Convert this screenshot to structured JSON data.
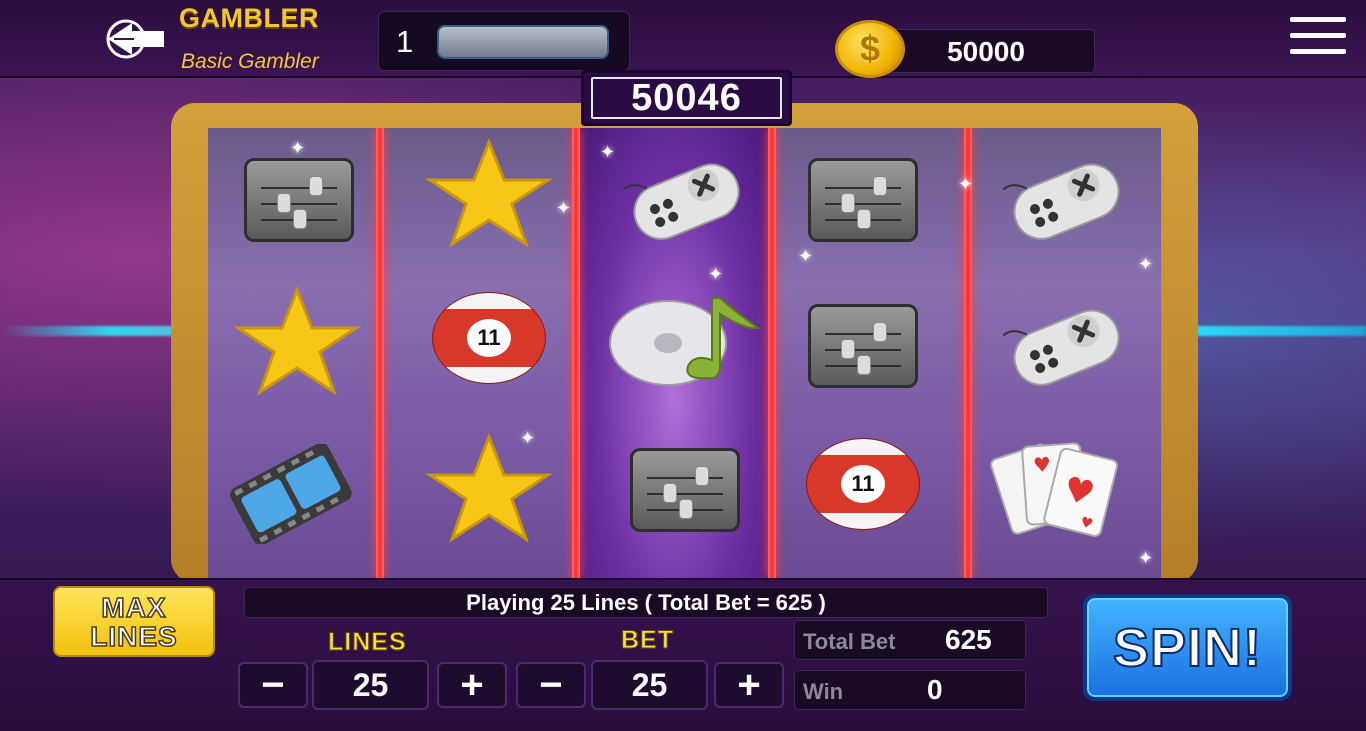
{
  "header": {
    "player_name": "GAMBLER",
    "player_rank": "Basic Gambler",
    "level": "1",
    "coins": "50000",
    "coin_symbol": "$"
  },
  "jackpot": "50046",
  "reels": [
    [
      "mixer-icon",
      "star-icon",
      "film-icon"
    ],
    [
      "star-icon",
      "billiard-ball-11-icon",
      "star-icon"
    ],
    [
      "gamepad-icon",
      "music-disc-icon",
      "mixer-icon"
    ],
    [
      "mixer-icon",
      "mixer-icon",
      "billiard-ball-11-icon"
    ],
    [
      "gamepad-icon",
      "gamepad-icon",
      "playing-cards-icon"
    ]
  ],
  "ball_number": "11",
  "controls": {
    "max_lines_top": "MAX",
    "max_lines_bottom": "LINES",
    "status": "Playing 25 Lines ( Total Bet = 625 )",
    "lines_label": "LINES",
    "lines_value": "25",
    "bet_label": "BET",
    "bet_value": "25",
    "minus": "−",
    "plus": "+",
    "total_bet_label": "Total Bet",
    "total_bet_value": "625",
    "win_label": "Win",
    "win_value": "0",
    "spin_label": "SPIN!"
  },
  "colors": {
    "gold": "#f2c632",
    "reel_divider": "#ff2a2a",
    "spin_blue": "#1a6fe0",
    "frame_gold": "#d4a03a"
  }
}
